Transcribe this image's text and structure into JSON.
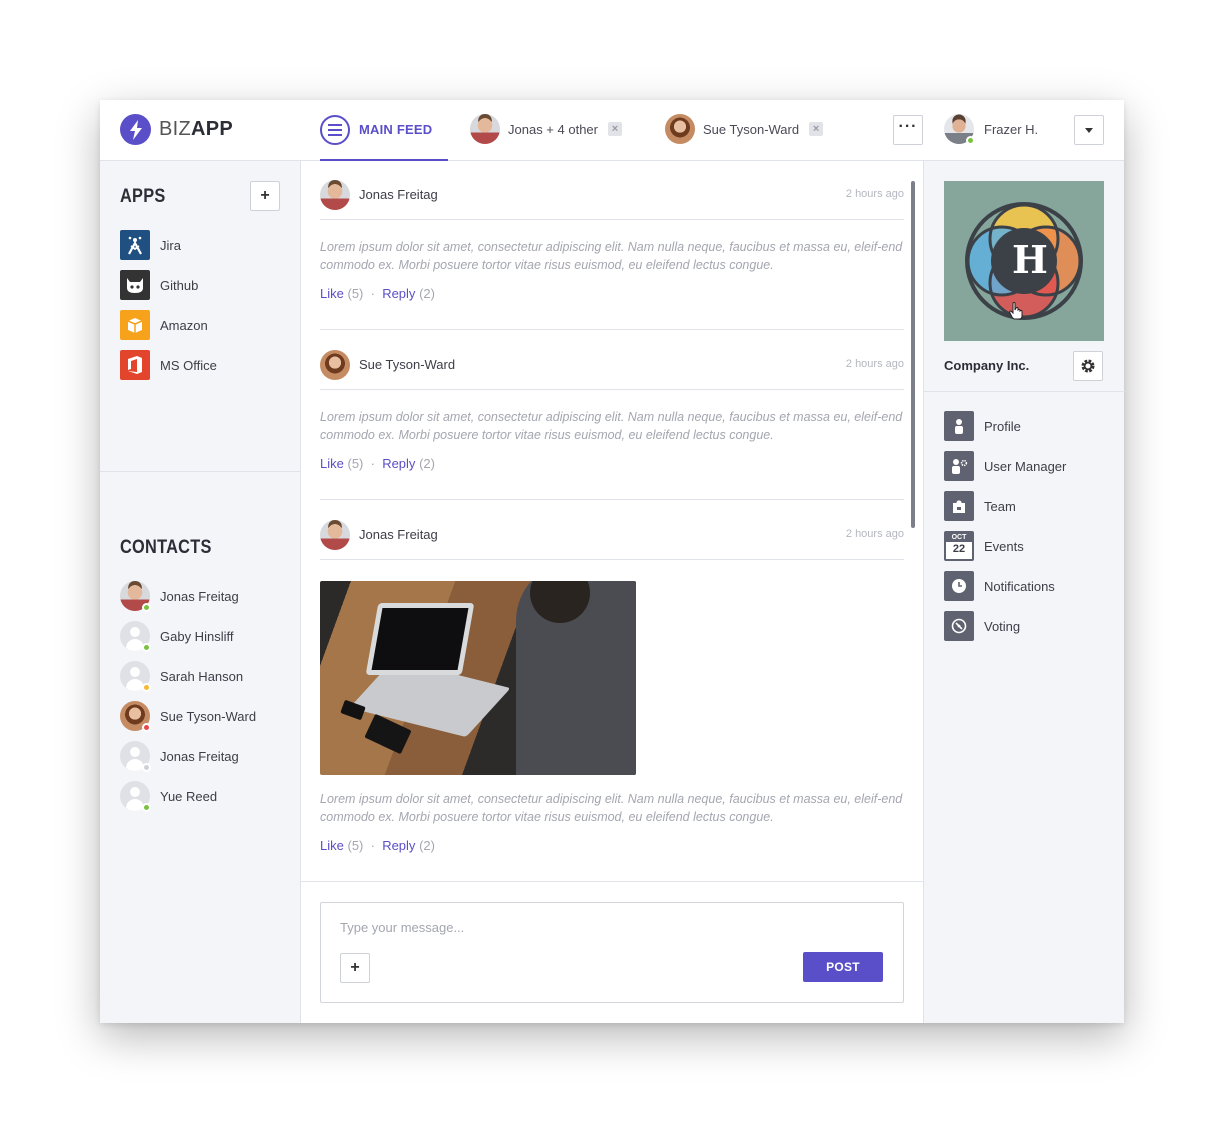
{
  "brand": {
    "light": "BIZ",
    "bold": "APP"
  },
  "tabs": {
    "main_feed": "MAIN FEED",
    "chats": [
      {
        "label": "Jonas + 4 other",
        "close": "×"
      },
      {
        "label": "Sue Tyson-Ward",
        "close": "×"
      }
    ],
    "more": "···"
  },
  "current_user": {
    "name": "Frazer H.",
    "status_color": "#7ac043"
  },
  "apps": {
    "title": "APPS",
    "add": "+",
    "items": [
      {
        "label": "Jira",
        "icon": "jira-icon",
        "color": "#205081"
      },
      {
        "label": "Github",
        "icon": "github-icon",
        "color": "#333333"
      },
      {
        "label": "Amazon",
        "icon": "amazon-icon",
        "color": "#f7a21b"
      },
      {
        "label": "MS Office",
        "icon": "ms-office-icon",
        "color": "#e3452c"
      }
    ]
  },
  "contacts": {
    "title": "CONTACTS",
    "items": [
      {
        "name": "Jonas Freitag",
        "status_color": "#7ac043"
      },
      {
        "name": "Gaby Hinsliff",
        "status_color": "#7ac043"
      },
      {
        "name": "Sarah Hanson",
        "status_color": "#f5b935"
      },
      {
        "name": "Sue Tyson-Ward",
        "status_color": "#e54b4b"
      },
      {
        "name": "Jonas Freitag",
        "status_color": "#cfd1d8"
      },
      {
        "name": "Yue Reed",
        "status_color": "#7ac043"
      }
    ]
  },
  "feed": {
    "posts": [
      {
        "author": "Jonas Freitag",
        "time": "2 hours ago",
        "text": "Lorem ipsum dolor sit amet, consectetur adipiscing elit. Nam nulla neque, faucibus et massa eu, eleif-end commodo ex. Morbi posuere tortor vitae risus euismod, eu eleifend lectus congue.",
        "like": "Like",
        "like_count": "(5)",
        "reply": "Reply",
        "reply_count": "(2)"
      },
      {
        "author": "Sue Tyson-Ward",
        "time": "2 hours ago",
        "text": "Lorem ipsum dolor sit amet, consectetur adipiscing elit. Nam nulla neque, faucibus et massa eu, eleif-end commodo ex. Morbi posuere tortor vitae risus euismod, eu eleifend lectus congue.",
        "like": "Like",
        "like_count": "(5)",
        "reply": "Reply",
        "reply_count": "(2)"
      },
      {
        "author": "Jonas Freitag",
        "time": "2 hours ago",
        "text": "Lorem ipsum dolor sit amet, consectetur adipiscing elit. Nam nulla neque, faucibus et massa eu, eleif-end commodo ex. Morbi posuere tortor vitae risus euismod, eu eleifend lectus congue.",
        "like": "Like",
        "like_count": "(5)",
        "reply": "Reply",
        "reply_count": "(2)"
      }
    ]
  },
  "composer": {
    "placeholder": "Type your message...",
    "add": "+",
    "post": "POST"
  },
  "company": {
    "name": "Company Inc.",
    "logo_letter": "H",
    "menu": [
      {
        "label": "Profile",
        "icon": "profile-icon"
      },
      {
        "label": "User Manager",
        "icon": "user-manager-icon"
      },
      {
        "label": "Team",
        "icon": "team-icon"
      },
      {
        "label": "Events",
        "icon": "calendar-icon",
        "month": "OCT",
        "day": "22"
      },
      {
        "label": "Notifications",
        "icon": "clock-icon"
      },
      {
        "label": "Voting",
        "icon": "compass-icon"
      }
    ]
  },
  "colors": {
    "accent": "#5a4fc8",
    "sidebar_bg": "#f4f5f9",
    "border": "#e1e3ea"
  }
}
